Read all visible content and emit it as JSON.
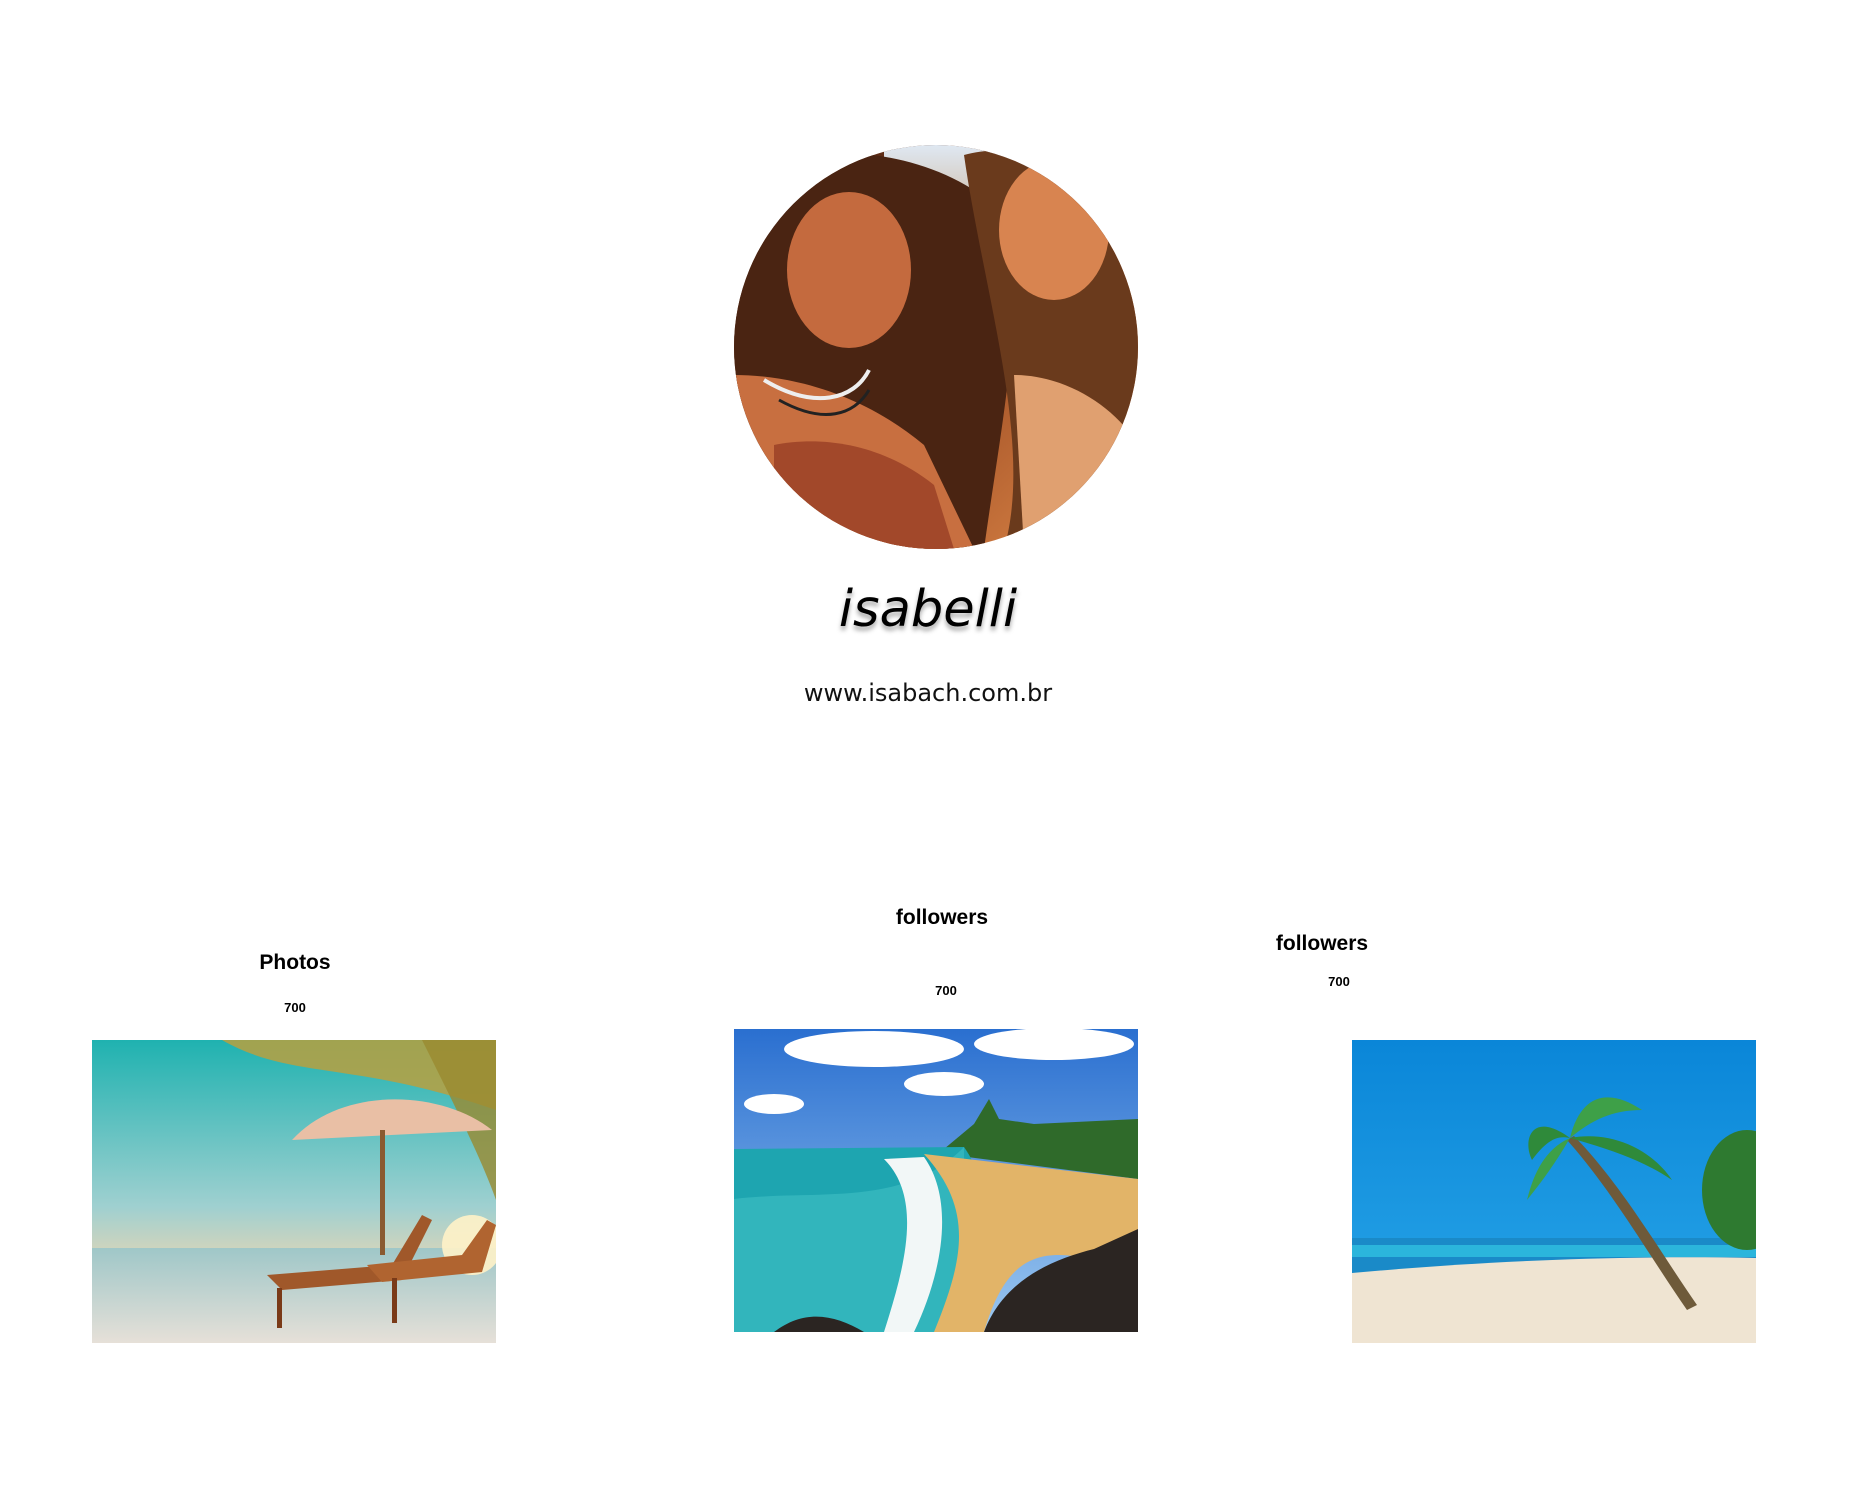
{
  "profile": {
    "name": "isabelli",
    "website": "www.isabach.com.br",
    "avatar_icon": "profile-photo"
  },
  "stats": [
    {
      "label": "Photos",
      "value": "700"
    },
    {
      "label": "followers",
      "value": "700"
    },
    {
      "label": "followers",
      "value": "700"
    }
  ],
  "gallery": [
    {
      "icon": "beach-umbrella-photo"
    },
    {
      "icon": "coastline-photo"
    },
    {
      "icon": "palm-tree-beach-photo"
    }
  ],
  "colors": {
    "background": "#ffffff",
    "text": "#000000"
  }
}
